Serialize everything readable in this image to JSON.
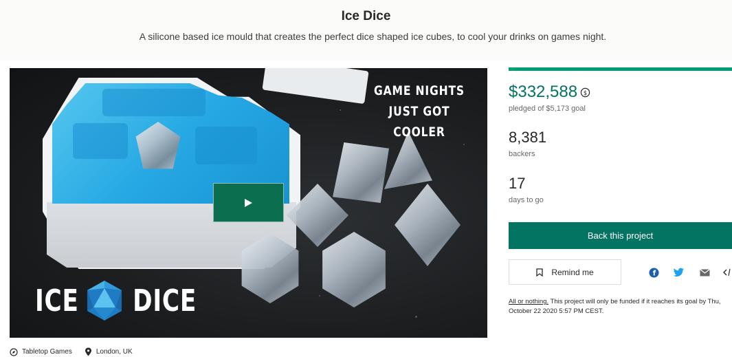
{
  "project": {
    "title": "Ice Dice",
    "blurb": "A silicone based ice mould that creates the perfect dice shaped ice cubes, to cool your drinks on games night."
  },
  "video": {
    "promo_line1": "GAME NIGHTS",
    "promo_line2": "JUST GOT COOLER",
    "brand_left": "ICE",
    "brand_right": "DICE",
    "play_icon": "play-icon"
  },
  "meta": {
    "category": "Tabletop Games",
    "category_icon": "compass-icon",
    "location": "London, UK",
    "location_icon": "map-pin-icon"
  },
  "stats": {
    "progress_fraction": 1.0,
    "pledged_amount": "$332,588",
    "pledged_label": "pledged of $5,173 goal",
    "backers_count": "8,381",
    "backers_label": "backers",
    "days_count": "17",
    "days_label": "days to go"
  },
  "actions": {
    "back_label": "Back this project",
    "remind_label": "Remind me",
    "remind_icon": "bookmark-icon",
    "share_icons": [
      "facebook-icon",
      "twitter-icon",
      "email-icon",
      "embed-icon"
    ]
  },
  "funding_note": {
    "link_text": "All or nothing.",
    "text": " This project will only be funded if it reaches its goal by Thu, October 22 2020 5:57 PM CEST."
  },
  "colors": {
    "accent_green": "#037362",
    "progress_green": "#009e74",
    "play_button": "#0b6e4f",
    "ice_blue": "#27a9e4"
  }
}
